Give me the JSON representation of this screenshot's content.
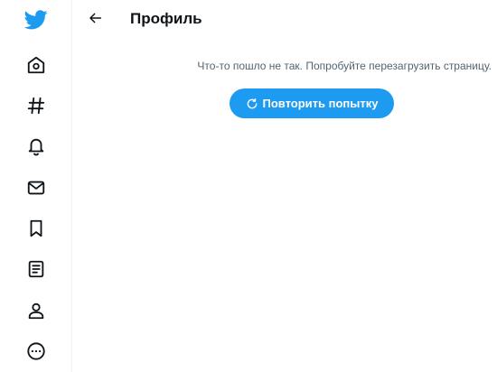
{
  "colors": {
    "brand": "#1d9bf0",
    "text_primary": "#0f1419",
    "text_secondary": "#536471",
    "divider": "#eff3f4"
  },
  "sidebar": {
    "items": [
      {
        "icon": "twitter-bird-icon"
      },
      {
        "icon": "home-icon"
      },
      {
        "icon": "hashtag-icon"
      },
      {
        "icon": "bell-icon"
      },
      {
        "icon": "mail-icon"
      },
      {
        "icon": "bookmark-icon"
      },
      {
        "icon": "list-icon"
      },
      {
        "icon": "profile-icon"
      },
      {
        "icon": "more-icon"
      }
    ]
  },
  "header": {
    "back_icon": "arrow-left-icon",
    "title": "Профиль"
  },
  "main": {
    "error_message": "Что-то пошло не так. Попробуйте перезагрузить страницу.",
    "retry_icon": "refresh-icon",
    "retry_label": "Повторить попытку"
  }
}
